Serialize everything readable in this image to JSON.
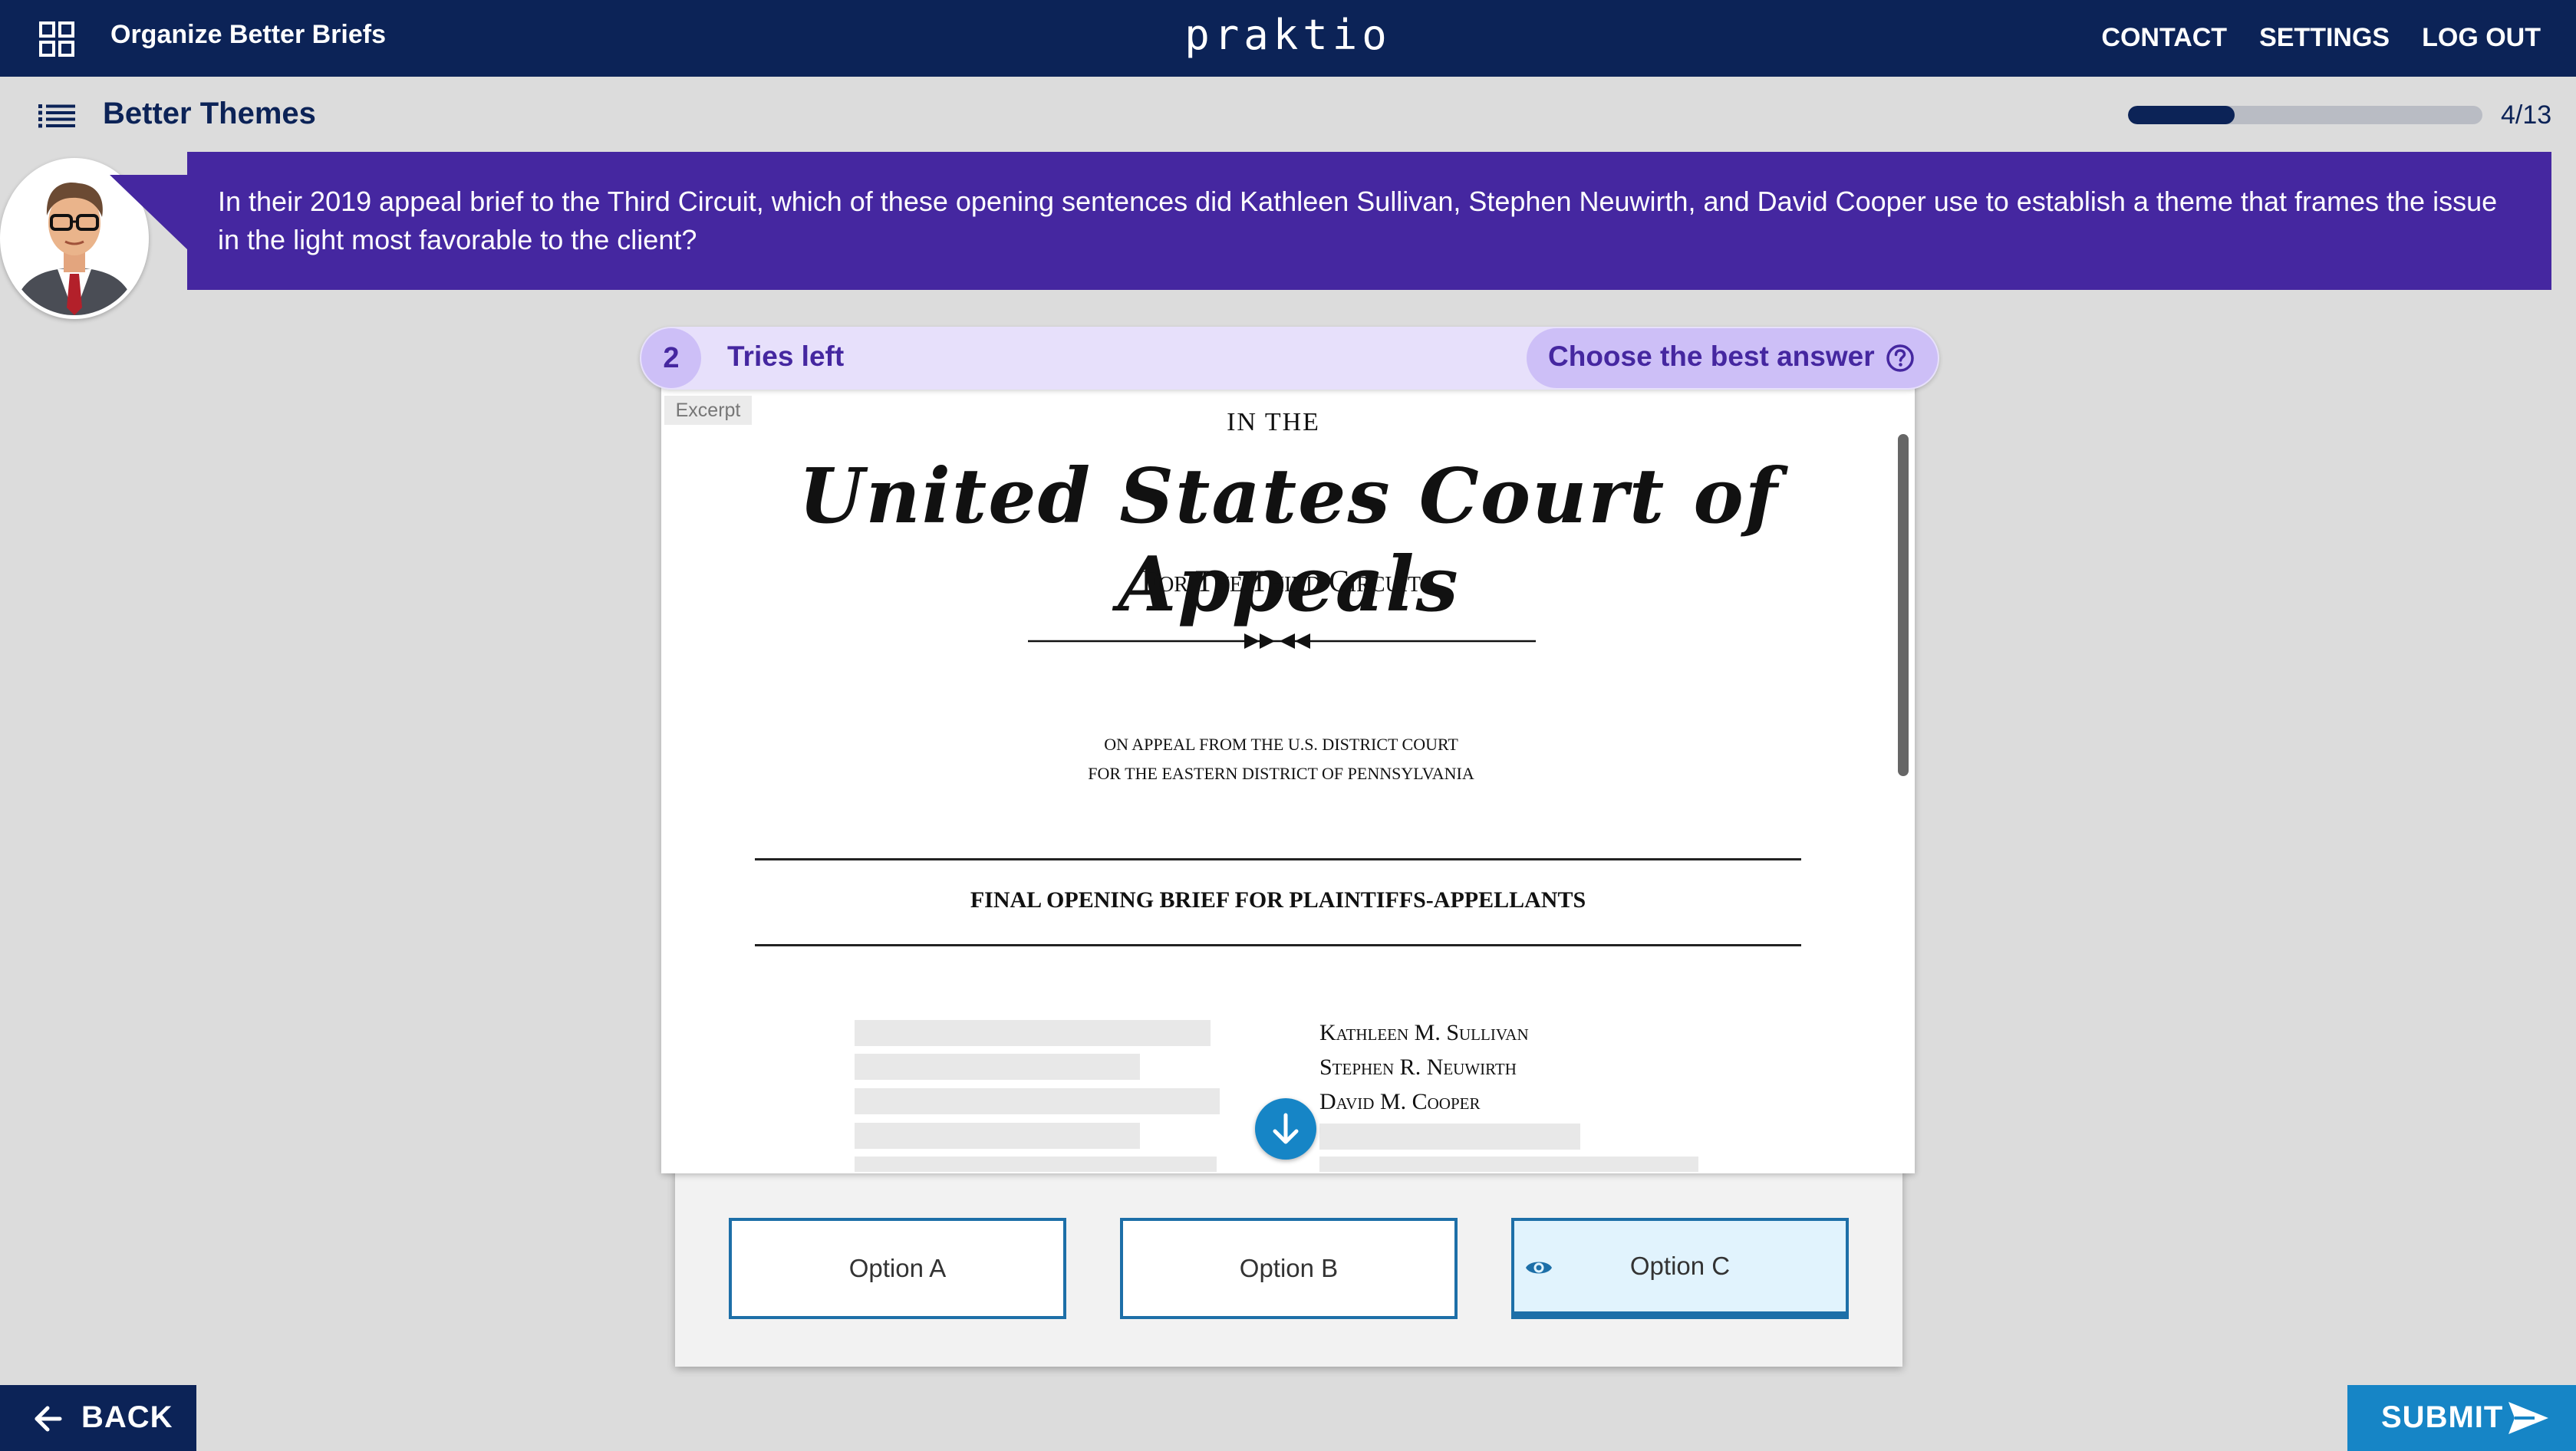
{
  "app": {
    "title": "Organize Better Briefs",
    "logo": "praktio",
    "nav": [
      "CONTACT",
      "SETTINGS",
      "LOG OUT"
    ]
  },
  "lesson": {
    "title": "Better Themes",
    "progress_fraction": 0.3,
    "progress_label": "4/13"
  },
  "question": {
    "text": "In their 2019 appeal brief to the Third Circuit, which of these opening sentences did Kathleen Sullivan, Stephen Neuwirth, and David Cooper use to establish a theme that frames the issue in the light most favorable to the client?"
  },
  "attempts": {
    "count": "2",
    "label": "Tries left",
    "instruction": "Choose the best answer"
  },
  "document": {
    "tag": "Excerpt",
    "in_the": "IN THE",
    "court": "United States Court of Appeals",
    "circuit": "For The Third Circuit",
    "appeal_line1": "ON APPEAL FROM THE U.S. DISTRICT COURT",
    "appeal_line2": "FOR THE EASTERN DISTRICT OF PENNSYLVANIA",
    "brief_title": "FINAL OPENING BRIEF FOR PLAINTIFFS-APPELLANTS",
    "counsel": [
      "Kathleen M. Sullivan",
      "Stephen R. Neuwirth",
      "David M. Cooper"
    ]
  },
  "options": [
    {
      "label": "Option A",
      "selected": false
    },
    {
      "label": "Option B",
      "selected": false
    },
    {
      "label": "Option C",
      "selected": true
    }
  ],
  "footer": {
    "back_label": "BACK",
    "submit_label": "SUBMIT"
  },
  "colors": {
    "navy": "#0c2357",
    "purple": "#4527a0",
    "lavender": "#e7e0fb",
    "blue": "#1685c6",
    "option_border": "#1d6fa8"
  }
}
